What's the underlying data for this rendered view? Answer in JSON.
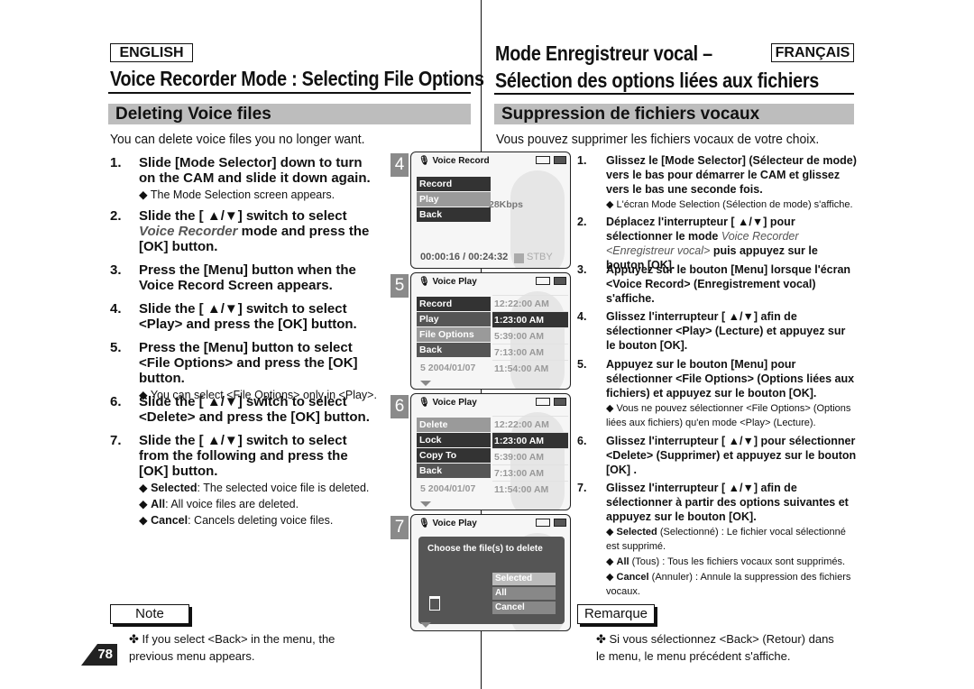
{
  "header": {
    "lang_en": "ENGLISH",
    "lang_fr": "FRANÇAIS",
    "title_en": "Voice Recorder Mode : Selecting File Options",
    "title_fr_1": "Mode Enregistreur vocal –",
    "title_fr_2": "Sélection des options liées aux fichiers"
  },
  "en": {
    "section": "Deleting Voice files",
    "intro": "You can delete voice files you no longer want.",
    "steps": [
      {
        "n": "1.",
        "parts": [
          {
            "t": "Slide [Mode Selector] down to turn on the CAM and slide it down again."
          }
        ],
        "subs": [
          [
            {
              "t": "◆ The Mode Selection screen appears."
            }
          ]
        ]
      },
      {
        "n": "2.",
        "parts": [
          {
            "t": "Slide the [ ▲/▼] switch to select "
          },
          {
            "t": "Voice Recorder",
            "i": 1
          },
          {
            "t": " mode and press the [OK] button."
          }
        ],
        "subs": []
      },
      {
        "n": "3.",
        "parts": [
          {
            "t": "Press the [Menu] button when the Voice Record Screen appears."
          }
        ],
        "subs": []
      },
      {
        "n": "4.",
        "parts": [
          {
            "t": "Slide the [ ▲/▼] switch to select <Play> and press the [OK] button."
          }
        ],
        "subs": []
      },
      {
        "n": "5.",
        "parts": [
          {
            "t": "Press the [Menu] button to select <File Options> and press the [OK] button."
          }
        ],
        "subs": [
          [
            {
              "t": "◆ You can select <File Options> only in <Play>."
            }
          ]
        ]
      },
      {
        "n": "6.",
        "parts": [
          {
            "t": "Slide the [ ▲/▼] switch to select <Delete> and press the [OK] button."
          }
        ],
        "subs": []
      },
      {
        "n": "7.",
        "parts": [
          {
            "t": "Slide the [ ▲/▼] switch to select from the following and press the [OK] button."
          }
        ],
        "subs": [
          [
            {
              "t": "◆ "
            },
            {
              "t": "Selected",
              "b": 1
            },
            {
              "t": ": The selected voice file is deleted."
            }
          ],
          [
            {
              "t": "◆ "
            },
            {
              "t": "All",
              "b": 1
            },
            {
              "t": ": All voice files are deleted."
            }
          ],
          [
            {
              "t": "◆ "
            },
            {
              "t": "Cancel",
              "b": 1
            },
            {
              "t": ": Cancels deleting voice files."
            }
          ]
        ]
      }
    ],
    "note_label": "Note",
    "note_text": "✤  If you select <Back> in the menu, the previous menu appears.",
    "page_number": "78"
  },
  "fr": {
    "section": "Suppression de fichiers vocaux",
    "intro": "Vous pouvez supprimer les fichiers vocaux de votre choix.",
    "steps": [
      {
        "n": "1.",
        "parts": [
          {
            "t": "Glissez le [Mode Selector] (Sélecteur de mode) vers le bas pour démarrer le CAM et glissez vers le bas une seconde fois."
          }
        ],
        "subs": [
          [
            {
              "t": "◆ L'écran Mode Selection (Sélection de mode) s'affiche."
            }
          ]
        ]
      },
      {
        "n": "2.",
        "parts": [
          {
            "t": "Déplacez l'interrupteur [ ▲/▼] pour sélectionner le mode "
          },
          {
            "t": "Voice Recorder <Enregistreur vocal>",
            "i": 1
          },
          {
            "t": " puis appuyez sur le bouton [OK]."
          }
        ],
        "subs": []
      },
      {
        "n": "3.",
        "parts": [
          {
            "t": "Appuyez sur le bouton [Menu] lorsque l'écran <Voice Record> (Enregistrement vocal) s'affiche."
          }
        ],
        "subs": []
      },
      {
        "n": "4.",
        "parts": [
          {
            "t": "Glissez l'interrupteur [ ▲/▼] afin de sélectionner <Play> (Lecture) et appuyez sur le bouton [OK]."
          }
        ],
        "subs": []
      },
      {
        "n": "5.",
        "parts": [
          {
            "t": "Appuyez sur le bouton [Menu] pour sélectionner <File Options> (Options liées aux fichiers) et appuyez sur le bouton [OK]."
          }
        ],
        "subs": [
          [
            {
              "t": "◆ Vous ne pouvez sélectionner <File Options> (Options liées aux fichiers) qu'en mode <Play> (Lecture)."
            }
          ]
        ]
      },
      {
        "n": "6.",
        "parts": [
          {
            "t": "Glissez l'interrupteur [ ▲/▼] pour sélectionner <Delete> (Supprimer) et appuyez sur le bouton [OK] ."
          }
        ],
        "subs": []
      },
      {
        "n": "7.",
        "parts": [
          {
            "t": "Glissez l'interrupteur [ ▲/▼] afin de sélectionner à partir des options suivantes et appuyez sur le bouton [OK]."
          }
        ],
        "subs": [
          [
            {
              "t": "◆ "
            },
            {
              "t": "Selected",
              "b": 1
            },
            {
              "t": " (Selectionné) : Le fichier vocal sélectionné est supprimé."
            }
          ],
          [
            {
              "t": "◆ "
            },
            {
              "t": "All",
              "b": 1
            },
            {
              "t": " (Tous) : Tous les fichiers vocaux sont supprimés."
            }
          ],
          [
            {
              "t": "◆ "
            },
            {
              "t": "Cancel",
              "b": 1
            },
            {
              "t": " (Annuler) : Annule la suppression des fichiers vocaux."
            }
          ]
        ]
      }
    ],
    "note_label": "Remarque",
    "note_text": "✤  Si vous sélectionnez <Back> (Retour) dans le menu, le menu précédent s'affiche."
  },
  "screens": [
    {
      "num": "4",
      "title": "Voice Record",
      "menu": [
        {
          "t": "Record",
          "s": ""
        },
        {
          "t": "Play",
          "s": "hl"
        },
        {
          "t": "Back",
          "s": ""
        }
      ],
      "times": [],
      "bitrate": "28Kbps",
      "timer": "00:00:16 / 00:24:32",
      "status": "STBY"
    },
    {
      "num": "5",
      "title": "Voice Play",
      "menu": [
        {
          "t": "Record",
          "s": ""
        },
        {
          "t": "Play",
          "s": "mid"
        },
        {
          "t": "File Options",
          "s": "hl"
        },
        {
          "t": "Back",
          "s": "mid"
        }
      ],
      "times": [
        {
          "t": "12:22:00 AM"
        },
        {
          "t": "1:23:00 AM",
          "sel": 1
        },
        {
          "t": "5:39:00 AM"
        },
        {
          "t": "7:13:00 AM"
        },
        {
          "t": "11:54:00 AM"
        }
      ],
      "row5": "5  2004/01/07"
    },
    {
      "num": "6",
      "title": "Voice Play",
      "menu": [
        {
          "t": "Delete",
          "s": "hl"
        },
        {
          "t": "Lock",
          "s": ""
        },
        {
          "t": "Copy To",
          "s": ""
        },
        {
          "t": "Back",
          "s": "mid"
        }
      ],
      "times": [
        {
          "t": "12:22:00 AM"
        },
        {
          "t": "1:23:00 AM",
          "sel": 1
        },
        {
          "t": "5:39:00 AM"
        },
        {
          "t": "7:13:00 AM"
        },
        {
          "t": "11:54:00 AM"
        }
      ],
      "row5": "5  2004/01/07"
    },
    {
      "num": "7",
      "title": "Voice Play",
      "dialog": "Choose the file(s) to delete",
      "options": [
        {
          "t": "Selected",
          "hl": 1
        },
        {
          "t": "All"
        },
        {
          "t": "Cancel"
        }
      ]
    }
  ]
}
